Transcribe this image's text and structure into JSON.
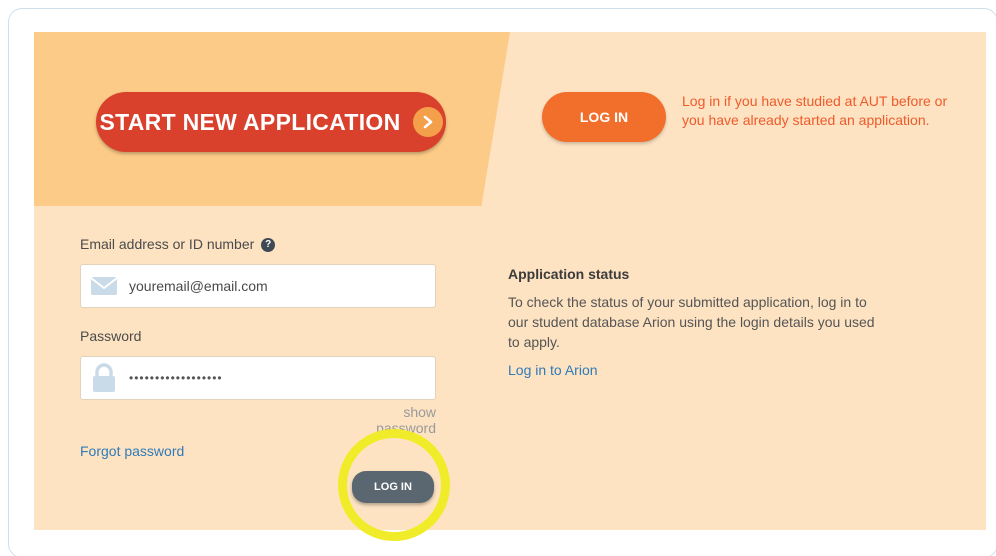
{
  "hero": {
    "start_label": "START NEW APPLICATION",
    "start_icon": "chevron-right-icon",
    "login_label": "LOG IN",
    "login_note": "Log in if you have studied at AUT before or you have already started an application."
  },
  "form": {
    "email_label": "Email address or ID number",
    "email_help_icon": "?",
    "email_value": "youremail@email.com",
    "email_icon": "envelope-icon",
    "password_label": "Password",
    "password_value": "••••••••••••••••••",
    "password_icon": "lock-icon",
    "show_password": "show password",
    "forgot_password": "Forgot password",
    "login_label": "LOG IN"
  },
  "status": {
    "title": "Application status",
    "body": "To check the status of your submitted application, log in to our student database Arion using the login details you used to apply.",
    "link": "Log in to Arion"
  },
  "colors": {
    "panel_bg": "#fde3c2",
    "hero_bg": "#fccb87",
    "start_button": "#d9412c",
    "login_top_button": "#f26e2b",
    "login_button": "#5a6670",
    "link": "#2f7ab8",
    "highlight": "#f1ec2a"
  }
}
